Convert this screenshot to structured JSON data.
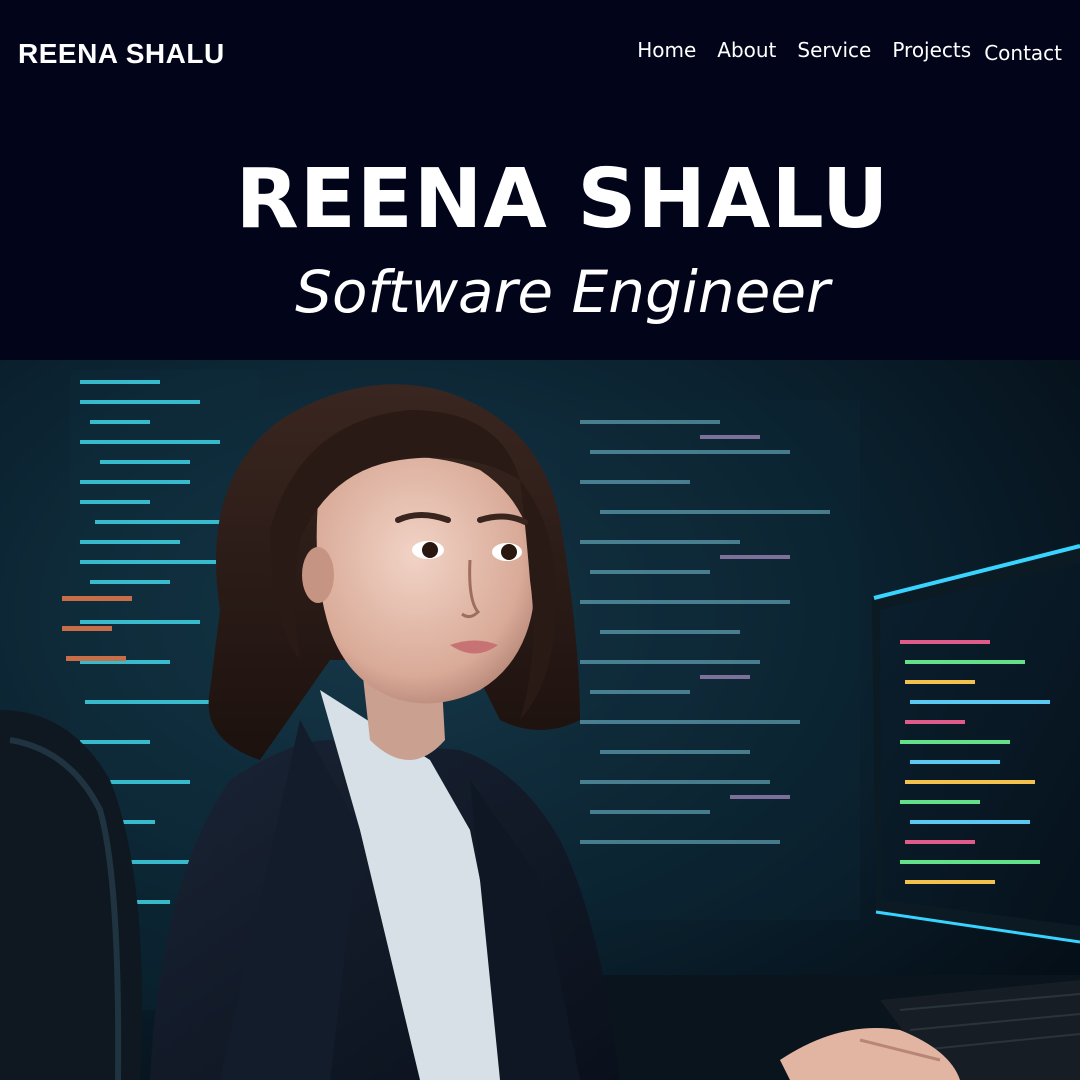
{
  "header": {
    "brand": "REENA SHALU",
    "nav": [
      {
        "label": "Home"
      },
      {
        "label": "About"
      },
      {
        "label": "Service"
      },
      {
        "label": "Projects"
      },
      {
        "label": "Contact"
      }
    ]
  },
  "hero": {
    "title": "REENA SHALU",
    "subtitle": "Software Engineer"
  },
  "colors": {
    "background": "#02041a",
    "text": "#ffffff",
    "accent": "#2ec4e6"
  }
}
